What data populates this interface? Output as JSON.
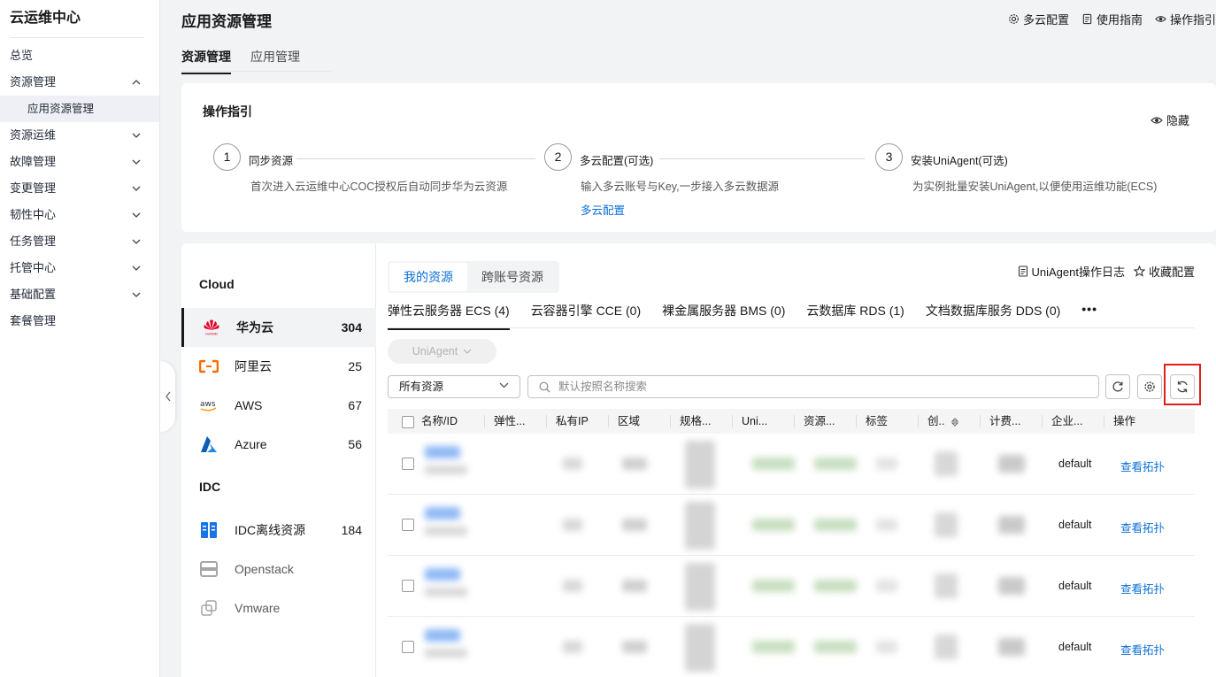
{
  "sidebar": {
    "title": "云运维中心",
    "items": [
      {
        "label": "总览"
      },
      {
        "label": "资源管理"
      },
      {
        "label": "应用资源管理"
      },
      {
        "label": "资源运维"
      },
      {
        "label": "故障管理"
      },
      {
        "label": "变更管理"
      },
      {
        "label": "韧性中心"
      },
      {
        "label": "任务管理"
      },
      {
        "label": "托管中心"
      },
      {
        "label": "基础配置"
      },
      {
        "label": "套餐管理"
      }
    ]
  },
  "header": {
    "title": "应用资源管理",
    "links": [
      "多云配置",
      "使用指南",
      "操作指引"
    ],
    "tabs": [
      "资源管理",
      "应用管理"
    ]
  },
  "guide": {
    "title": "操作指引",
    "hide": "隐藏",
    "steps": [
      {
        "num": "1",
        "title": "同步资源",
        "desc": "首次进入云运维中心COC授权后自动同步华为云资源"
      },
      {
        "num": "2",
        "title": "多云配置(可选)",
        "desc": "输入多云账号与Key,一步接入多云数据源",
        "link": "多云配置"
      },
      {
        "num": "3",
        "title": "安装UniAgent(可选)",
        "desc": "为实例批量安装UniAgent,以便使用运维功能(ECS)"
      }
    ]
  },
  "providers": {
    "cloud_header": "Cloud",
    "idc_header": "IDC",
    "cloud": [
      {
        "name": "华为云",
        "count": "304",
        "icon": "huawei-logo"
      },
      {
        "name": "阿里云",
        "count": "25",
        "icon": "aliyun-logo"
      },
      {
        "name": "AWS",
        "count": "67",
        "icon": "aws-logo"
      },
      {
        "name": "Azure",
        "count": "56",
        "icon": "azure-logo"
      }
    ],
    "idc": [
      {
        "name": "IDC离线资源",
        "count": "184",
        "icon": "idc-logo"
      },
      {
        "name": "Openstack",
        "count": "",
        "icon": "openstack-logo"
      },
      {
        "name": "Vmware",
        "count": "",
        "icon": "vmware-logo"
      }
    ]
  },
  "resources": {
    "segments": [
      "我的资源",
      "跨账号资源"
    ],
    "links": [
      "UniAgent操作日志",
      "收藏配置"
    ],
    "service_tabs": [
      "弹性云服务器 ECS (4)",
      "云容器引擎 CCE (0)",
      "裸金属服务器 BMS (0)",
      "云数据库 RDS (1)",
      "文档数据库服务 DDS (0)"
    ],
    "more": "•••",
    "uniagent_button": "UniAgent",
    "filter_select": "所有资源",
    "search_placeholder": "默认按照名称搜索",
    "columns": [
      "名称/ID",
      "弹性...",
      "私有IP",
      "区域",
      "规格...",
      "Uni...",
      "资源...",
      "标签",
      "创..",
      "计费...",
      "企业...",
      "操作"
    ],
    "rows": [
      {
        "enterprise": "default",
        "action": "查看拓扑"
      },
      {
        "enterprise": "default",
        "action": "查看拓扑"
      },
      {
        "enterprise": "default",
        "action": "查看拓扑"
      },
      {
        "enterprise": "default",
        "action": "查看拓扑"
      }
    ]
  },
  "colors": {
    "link": "#0a6fd8",
    "highlight": "#e02020",
    "primary_text": "#191919"
  }
}
